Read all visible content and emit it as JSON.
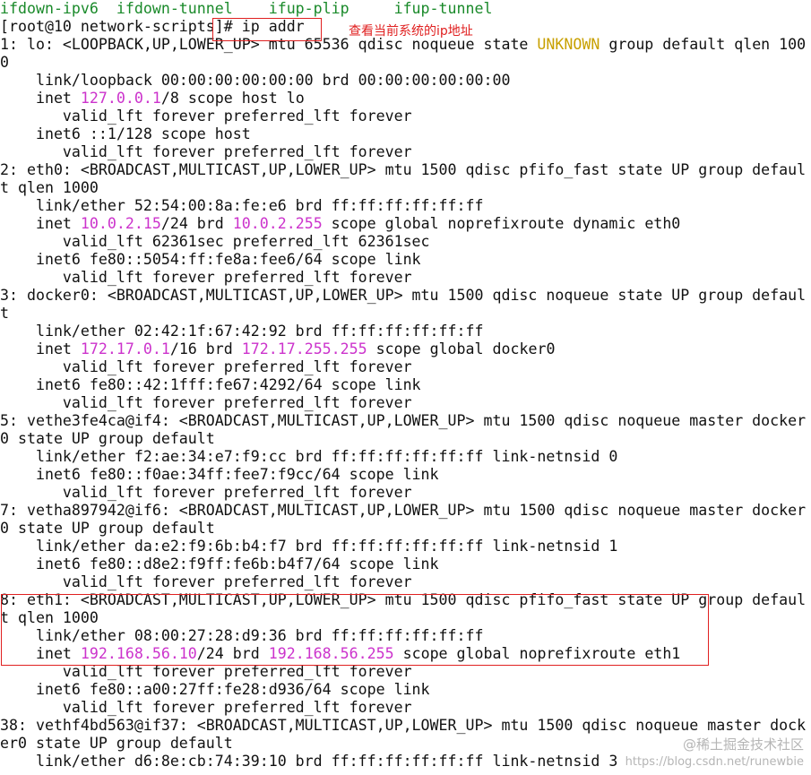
{
  "terminal": {
    "lines": [
      [
        [
          "ifdown-ipv6  ifdown-tunnel    ifup-plip     ifup-tunnel",
          "g"
        ]
      ],
      [
        [
          "[root@10 network-scripts]# ip addr",
          ""
        ]
      ],
      [
        [
          "1: lo: <LOOPBACK,UP,LOWER_UP> mtu 65536 qdisc noqueue state ",
          ""
        ],
        [
          "UNKNOWN",
          "y"
        ],
        [
          " group default qlen 100",
          ""
        ]
      ],
      [
        [
          "0",
          ""
        ]
      ],
      [
        [
          "    link/loopback 00:00:00:00:00:00 brd 00:00:00:00:00:00",
          ""
        ]
      ],
      [
        [
          "    inet ",
          ""
        ],
        [
          "127.0.0.1",
          "m"
        ],
        [
          "/8 scope host lo",
          ""
        ]
      ],
      [
        [
          "       valid_lft forever preferred_lft forever",
          ""
        ]
      ],
      [
        [
          "    inet6 ::1/128 scope host",
          ""
        ]
      ],
      [
        [
          "       valid_lft forever preferred_lft forever",
          ""
        ]
      ],
      [
        [
          "2: eth0: <BROADCAST,MULTICAST,UP,LOWER_UP> mtu 1500 qdisc pfifo_fast state UP group defaul",
          ""
        ]
      ],
      [
        [
          "t qlen 1000",
          ""
        ]
      ],
      [
        [
          "    link/ether 52:54:00:8a:fe:e6 brd ff:ff:ff:ff:ff:ff",
          ""
        ]
      ],
      [
        [
          "    inet ",
          ""
        ],
        [
          "10.0.2.15",
          "m"
        ],
        [
          "/24 brd ",
          ""
        ],
        [
          "10.0.2.255",
          "m"
        ],
        [
          " scope global noprefixroute dynamic eth0",
          ""
        ]
      ],
      [
        [
          "       valid_lft 62361sec preferred_lft 62361sec",
          ""
        ]
      ],
      [
        [
          "    inet6 fe80::5054:ff:fe8a:fee6/64 scope link",
          ""
        ]
      ],
      [
        [
          "       valid_lft forever preferred_lft forever",
          ""
        ]
      ],
      [
        [
          "3: docker0: <BROADCAST,MULTICAST,UP,LOWER_UP> mtu 1500 qdisc noqueue state UP group defaul",
          ""
        ]
      ],
      [
        [
          "t",
          ""
        ]
      ],
      [
        [
          "    link/ether 02:42:1f:67:42:92 brd ff:ff:ff:ff:ff:ff",
          ""
        ]
      ],
      [
        [
          "    inet ",
          ""
        ],
        [
          "172.17.0.1",
          "m"
        ],
        [
          "/16 brd ",
          ""
        ],
        [
          "172.17.255.255",
          "m"
        ],
        [
          " scope global docker0",
          ""
        ]
      ],
      [
        [
          "       valid_lft forever preferred_lft forever",
          ""
        ]
      ],
      [
        [
          "    inet6 fe80::42:1fff:fe67:4292/64 scope link",
          ""
        ]
      ],
      [
        [
          "       valid_lft forever preferred_lft forever",
          ""
        ]
      ],
      [
        [
          "5: vethe3fe4ca@if4: <BROADCAST,MULTICAST,UP,LOWER_UP> mtu 1500 qdisc noqueue master docker",
          ""
        ]
      ],
      [
        [
          "0 state UP group default",
          ""
        ]
      ],
      [
        [
          "    link/ether f2:ae:34:e7:f9:cc brd ff:ff:ff:ff:ff:ff link-netnsid 0",
          ""
        ]
      ],
      [
        [
          "    inet6 fe80::f0ae:34ff:fee7:f9cc/64 scope link",
          ""
        ]
      ],
      [
        [
          "       valid_lft forever preferred_lft forever",
          ""
        ]
      ],
      [
        [
          "7: vetha897942@if6: <BROADCAST,MULTICAST,UP,LOWER_UP> mtu 1500 qdisc noqueue master docker",
          ""
        ]
      ],
      [
        [
          "0 state UP group default",
          ""
        ]
      ],
      [
        [
          "    link/ether da:e2:f9:6b:b4:f7 brd ff:ff:ff:ff:ff:ff link-netnsid 1",
          ""
        ]
      ],
      [
        [
          "    inet6 fe80::d8e2:f9ff:fe6b:b4f7/64 scope link",
          ""
        ]
      ],
      [
        [
          "       valid_lft forever preferred_lft forever",
          ""
        ]
      ],
      [
        [
          "8: eth1: <BROADCAST,MULTICAST,UP,LOWER_UP> mtu 1500 qdisc pfifo_fast state UP group defaul",
          ""
        ]
      ],
      [
        [
          "t qlen 1000",
          ""
        ]
      ],
      [
        [
          "    link/ether 08:00:27:28:d9:36 brd ff:ff:ff:ff:ff:ff",
          ""
        ]
      ],
      [
        [
          "    inet ",
          ""
        ],
        [
          "192.168.56.10",
          "m"
        ],
        [
          "/24 brd ",
          ""
        ],
        [
          "192.168.56.255",
          "m"
        ],
        [
          " scope global noprefixroute eth1",
          ""
        ]
      ],
      [
        [
          "       valid_lft forever preferred_lft forever",
          ""
        ]
      ],
      [
        [
          "    inet6 fe80::a00:27ff:fe28:d936/64 scope link",
          ""
        ]
      ],
      [
        [
          "       valid_lft forever preferred_lft forever",
          ""
        ]
      ],
      [
        [
          "38: vethf4bd563@if37: <BROADCAST,MULTICAST,UP,LOWER_UP> mtu 1500 qdisc noqueue master dock",
          ""
        ]
      ],
      [
        [
          "er0 state UP group default",
          ""
        ]
      ],
      [
        [
          "    link/ether d6:8e:cb:74:39:10 brd ff:ff:ff:ff:ff:ff link-netnsid 3",
          ""
        ]
      ]
    ]
  },
  "annotation": {
    "text": "查看当前系统的ip地址",
    "color": "#e02020"
  },
  "watermark": {
    "logo": "@稀土掘金技术社区",
    "url": "https://blog.csdn.net/runewbie"
  },
  "colors": {
    "background": "#ffffff",
    "text": "#111111",
    "filename_green": "#1a8a2a",
    "address_magenta": "#cc33cc",
    "state_yellow": "#c8a000",
    "highlight_red": "#e02020"
  }
}
